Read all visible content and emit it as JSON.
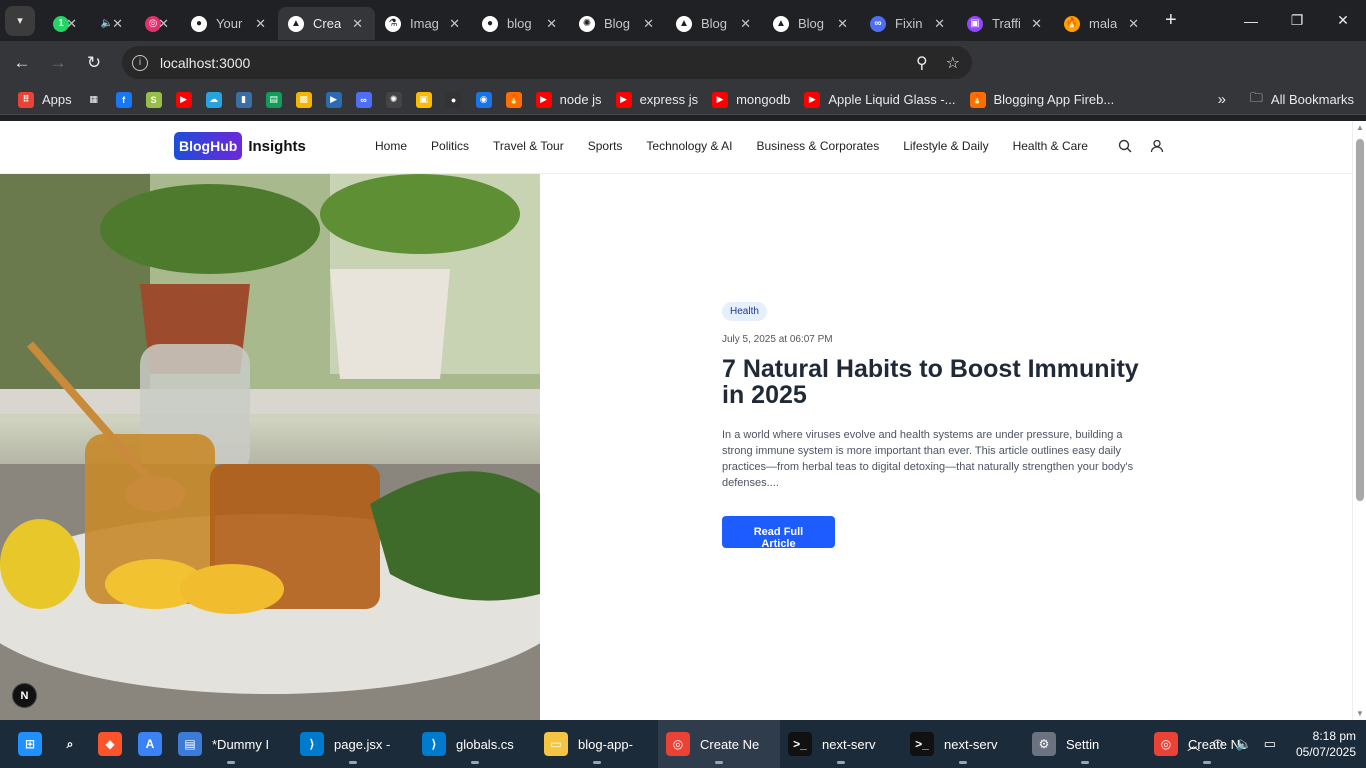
{
  "tabs": [
    {
      "label": "",
      "icon": "whatsapp-icon",
      "color": "#25d366",
      "glyph": "1"
    },
    {
      "label": "",
      "icon": "speaker-icon",
      "color": "#202124",
      "glyph": "🔈"
    },
    {
      "label": "",
      "icon": "instagram-icon",
      "color": "#e1306c",
      "glyph": "◎"
    },
    {
      "label": "Your",
      "icon": "github-icon",
      "color": "#ffffff",
      "glyph": "●"
    },
    {
      "label": "Creat",
      "icon": "vercel-icon",
      "color": "#ffffff",
      "glyph": "▲",
      "active": true
    },
    {
      "label": "Imag",
      "icon": "flask-icon",
      "color": "#ffffff",
      "glyph": "⚗"
    },
    {
      "label": "blog",
      "icon": "github-icon",
      "color": "#ffffff",
      "glyph": "●"
    },
    {
      "label": "Blog",
      "icon": "openai-icon",
      "color": "#ffffff",
      "glyph": "✺"
    },
    {
      "label": "Blog",
      "icon": "vercel-icon",
      "color": "#ffffff",
      "glyph": "▲"
    },
    {
      "label": "Blog",
      "icon": "vercel-icon",
      "color": "#ffffff",
      "glyph": "▲"
    },
    {
      "label": "Fixin",
      "icon": "ai-icon",
      "color": "#4f6ef7",
      "glyph": "∞"
    },
    {
      "label": "Traffi",
      "icon": "twitch-icon",
      "color": "#9146ff",
      "glyph": "▣"
    },
    {
      "label": "mala",
      "icon": "firebase-icon",
      "color": "#ffa000",
      "glyph": "🔥"
    }
  ],
  "address": {
    "url": "localhost:3000"
  },
  "bookmarks": [
    {
      "label": "Apps",
      "icon": "apps-grid-icon",
      "color": "#ea4335",
      "glyph": "⠿"
    },
    {
      "label": "",
      "icon": "grid-icon",
      "color": "#35363a",
      "glyph": "▦"
    },
    {
      "label": "",
      "icon": "facebook-icon",
      "color": "#1877f2",
      "glyph": "f"
    },
    {
      "label": "",
      "icon": "shopify-icon",
      "color": "#95bf47",
      "glyph": "S"
    },
    {
      "label": "",
      "icon": "youtube-icon",
      "color": "#ff0000",
      "glyph": "▶"
    },
    {
      "label": "",
      "icon": "cloud-icon",
      "color": "#29a3e0",
      "glyph": "☁"
    },
    {
      "label": "",
      "icon": "bottle-icon",
      "color": "#3a6ea5",
      "glyph": "▮"
    },
    {
      "label": "",
      "icon": "sheets-icon",
      "color": "#0f9d58",
      "glyph": "▤"
    },
    {
      "label": "",
      "icon": "photos-icon",
      "color": "#f4b400",
      "glyph": "▩"
    },
    {
      "label": "",
      "icon": "video-icon",
      "color": "#2b6cb0",
      "glyph": "▶"
    },
    {
      "label": "",
      "icon": "ai-icon",
      "color": "#4f6ef7",
      "glyph": "∞"
    },
    {
      "label": "",
      "icon": "openai-icon",
      "color": "#444444",
      "glyph": "✺"
    },
    {
      "label": "",
      "icon": "keep-icon",
      "color": "#fbbc04",
      "glyph": "▣"
    },
    {
      "label": "",
      "icon": "github-icon",
      "color": "#333333",
      "glyph": "●"
    },
    {
      "label": "",
      "icon": "circle-icon",
      "color": "#1a73e8",
      "glyph": "◉"
    },
    {
      "label": "",
      "icon": "firebase-icon",
      "color": "#ff6d00",
      "glyph": "🔥"
    },
    {
      "label": "node js",
      "icon": "youtube-icon",
      "color": "#ff0000",
      "glyph": "▶"
    },
    {
      "label": "express js",
      "icon": "youtube-icon",
      "color": "#ff0000",
      "glyph": "▶"
    },
    {
      "label": "mongodb",
      "icon": "youtube-icon",
      "color": "#ff0000",
      "glyph": "▶"
    },
    {
      "label": "Apple Liquid Glass -...",
      "icon": "youtube-icon",
      "color": "#ff0000",
      "glyph": "▶"
    },
    {
      "label": "Blogging App Fireb...",
      "icon": "firebase-icon",
      "color": "#ff6d00",
      "glyph": "🔥"
    }
  ],
  "bookmarks_all": "All Bookmarks",
  "site": {
    "logo_badge": "BlogHub",
    "logo_name": "Insights",
    "menu": [
      "Home",
      "Politics",
      "Travel & Tour",
      "Sports",
      "Technology & AI",
      "Business & Corporates",
      "Lifestyle & Daily",
      "Health & Care"
    ]
  },
  "article": {
    "category": "Health",
    "date": "July 5, 2025 at 06:07 PM",
    "title": "7 Natural Habits to Boost Immunity in 2025",
    "excerpt": "In a world where viruses evolve and health systems are under pressure, building a strong immune system is more important than ever. This article outlines easy daily practices—from herbal teas to digital detoxing—that naturally strengthen your body's defenses....",
    "cta": "Read Full Article"
  },
  "nextjs_badge": "N",
  "taskbar": [
    {
      "label": "",
      "icon": "windows-start-icon",
      "color": "#1e90ff",
      "glyph": "⊞"
    },
    {
      "label": "",
      "icon": "search-icon",
      "color": "#1c2b3a",
      "glyph": "⌕"
    },
    {
      "label": "",
      "icon": "brave-icon",
      "color": "#fb542b",
      "glyph": "◆"
    },
    {
      "label": "",
      "icon": "app-icon",
      "color": "#3b82f6",
      "glyph": "A"
    },
    {
      "label": "*Dummy I",
      "icon": "notepad-icon",
      "color": "#3d7bd9",
      "glyph": "▤"
    },
    {
      "label": "page.jsx -",
      "icon": "vscode-icon",
      "color": "#007acc",
      "glyph": "⟩"
    },
    {
      "label": "globals.cs",
      "icon": "vscode-icon",
      "color": "#007acc",
      "glyph": "⟩"
    },
    {
      "label": "blog-app-",
      "icon": "folder-icon",
      "color": "#f4c542",
      "glyph": "▭"
    },
    {
      "label": "Create Ne",
      "icon": "chrome-icon",
      "color": "#ea4335",
      "glyph": "◎",
      "active": true
    },
    {
      "label": "next-serv",
      "icon": "terminal-icon",
      "color": "#111111",
      "glyph": ">_"
    },
    {
      "label": "next-serv",
      "icon": "terminal-icon",
      "color": "#111111",
      "glyph": ">_"
    },
    {
      "label": "Settin",
      "icon": "settings-icon",
      "color": "#6b7280",
      "glyph": "⚙"
    },
    {
      "label": "Create Ne",
      "icon": "chrome-icon",
      "color": "#ea4335",
      "glyph": "◎"
    }
  ],
  "clock": {
    "time": "8:18 pm",
    "date": "05/07/2025"
  }
}
